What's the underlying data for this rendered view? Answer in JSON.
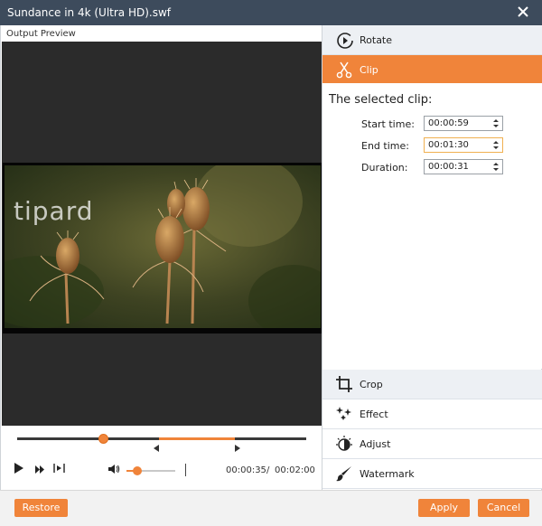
{
  "window": {
    "title": "Sundance in 4k (Ultra HD).swf"
  },
  "preview": {
    "label": "Output Preview",
    "watermark": "tipard"
  },
  "playback": {
    "progress": 0.297,
    "clip_start": 0.492,
    "clip_end": 0.754,
    "volume": 0.22,
    "current_time": "00:00:35",
    "separator": "/",
    "total_time": "00:02:00"
  },
  "tools": {
    "rotate": "Rotate",
    "clip": "Clip",
    "crop": "Crop",
    "effect": "Effect",
    "adjust": "Adjust",
    "watermark": "Watermark"
  },
  "clip": {
    "heading": "The selected clip:",
    "start_label": "Start time:",
    "start_value": "00:00:59",
    "end_label": "End time:",
    "end_value": "00:01:30",
    "duration_label": "Duration:",
    "duration_value": "00:00:31"
  },
  "buttons": {
    "restore": "Restore",
    "apply": "Apply",
    "cancel": "Cancel"
  },
  "colors": {
    "accent": "#f0843a",
    "titlebar": "#3d4b5c"
  }
}
